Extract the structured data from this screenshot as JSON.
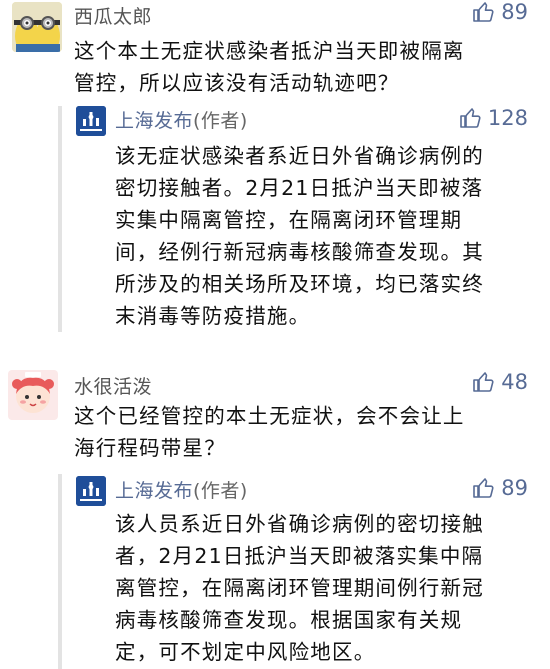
{
  "comments": [
    {
      "username": "西瓜太郎",
      "likes": "89",
      "text_lines": [
        "这个本土无症状感染者抵沪当天即被隔离",
        "管控，所以应该没有活动轨迹吧？"
      ],
      "reply": {
        "author": "上海发布",
        "author_tag": "(作者)",
        "likes": "128",
        "avatar_label": "上海发布",
        "text_lines": [
          "该无症状感染者系近日外省确诊病例的",
          "密切接触者。2月21日抵沪当天即被落",
          "实集中隔离管控，在隔离闭环管理期",
          "间，经例行新冠病毒核酸筛查发现。其",
          "所涉及的相关场所及环境，均已落实终",
          "末消毒等防疫措施。"
        ]
      }
    },
    {
      "username": "水很活泼",
      "likes": "48",
      "text_lines": [
        "这个已经管控的本土无症状，会不会让上",
        "海行程码带星？"
      ],
      "reply": {
        "author": "上海发布",
        "author_tag": "(作者)",
        "likes": "89",
        "avatar_label": "上海发布",
        "text_lines": [
          "该人员系近日外省确诊病例的密切接触",
          "者，2月21日抵沪当天即被落实集中隔",
          "离管控，在隔离闭环管理期间例行新冠",
          "病毒核酸筛查发现。根据国家有关规",
          "定，可不划定中风险地区。"
        ]
      }
    }
  ],
  "colors": {
    "accent": "#576b95",
    "text": "#111111",
    "meta": "#555555",
    "official_avatar": "#1f4e99"
  }
}
